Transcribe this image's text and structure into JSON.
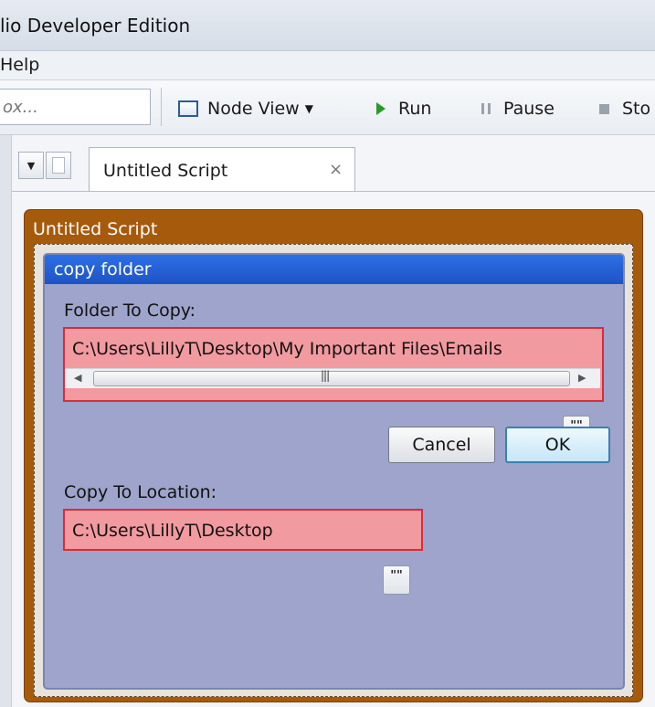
{
  "window": {
    "title": "lio Developer Edition"
  },
  "menubar": {
    "items": [
      "Help"
    ]
  },
  "toolbar": {
    "search_placeholder": "ox...",
    "node_view_label": "Node View",
    "run_label": "Run",
    "pause_label": "Pause",
    "stop_label": "Sto"
  },
  "tabs": [
    {
      "label": "Untitled Script",
      "close_glyph": "×"
    }
  ],
  "script": {
    "title": "Untitled Script"
  },
  "dialog": {
    "title": "copy folder",
    "folder_to_copy": {
      "label": "Folder To Copy:",
      "value": "C:\\Users\\LillyT\\Desktop\\My Important Files\\Emails",
      "browse_label": "\"\""
    },
    "copy_to_location": {
      "label": "Copy To Location:",
      "value": "C:\\Users\\LillyT\\Desktop",
      "browse_label": "\"\""
    },
    "cancel_label": "Cancel",
    "ok_label": "OK"
  },
  "colors": {
    "script_frame": "#a65a0c",
    "dialog_header": "#2563d8",
    "dialog_body": "#9ea4cb",
    "invalid_field_fill": "#f19aa0",
    "invalid_field_border": "#d62d3a"
  },
  "icons": [
    "node-view-icon",
    "run-icon",
    "pause-icon",
    "stop-icon",
    "tab-dropdown-icon",
    "new-document-icon",
    "close-icon",
    "scroll-left-icon",
    "scroll-right-icon"
  ]
}
